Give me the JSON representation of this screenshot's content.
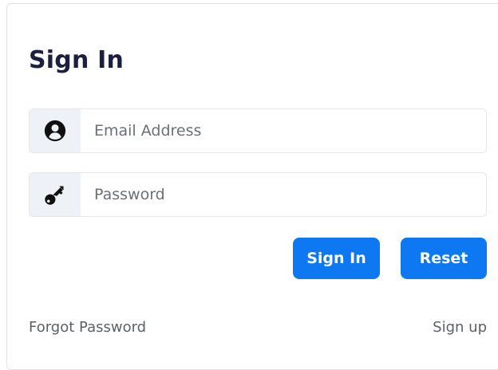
{
  "form": {
    "title": "Sign In",
    "email": {
      "placeholder": "Email Address",
      "value": "",
      "icon": "user-circle-icon"
    },
    "password": {
      "placeholder": "Password",
      "value": "",
      "icon": "key-icon"
    },
    "signin_label": "Sign In",
    "reset_label": "Reset",
    "forgot_label": "Forgot Password",
    "signup_label": "Sign up"
  },
  "colors": {
    "accent": "#0d78f2",
    "title": "#1d1f3e",
    "addon_bg": "#eef1f6",
    "link": "#5b5f66"
  }
}
